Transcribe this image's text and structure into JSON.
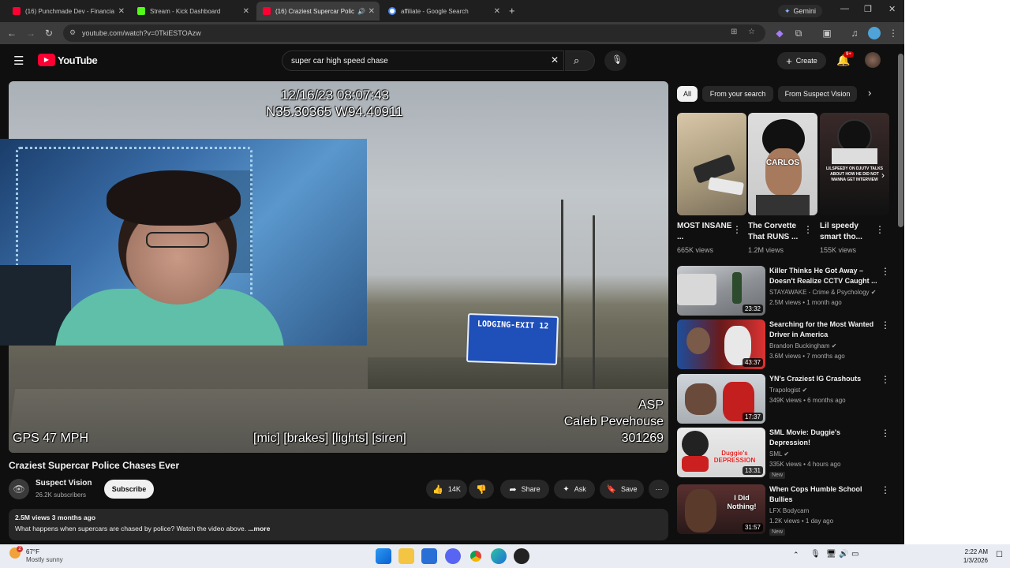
{
  "browser": {
    "tabs": [
      {
        "title": "(16) Punchmade Dev - Financia",
        "color": "#ff0033"
      },
      {
        "title": "Stream - Kick Dashboard",
        "color": "#53fc18"
      },
      {
        "title": "(16) Craziest Supercar Polic",
        "color": "#ff0033"
      },
      {
        "title": "affiliate - Google Search",
        "color": "#4285f4"
      }
    ],
    "gemini": "Gemini",
    "url": "youtube.com/watch?v=0TkiESTOAzw"
  },
  "youtube": {
    "logo": "YouTube",
    "search_query": "super car high speed chase",
    "create_label": "Create",
    "notifications": "9+"
  },
  "video": {
    "timestamp": "12/16/23 08:07:43",
    "coords": "N35.30365 W94.40911",
    "sign_text": "LODGING-EXIT 12",
    "gps": "GPS 47 MPH",
    "indicators": "[mic] [brakes] [lights] [siren]",
    "agency": "ASP",
    "officer": "Caleb Pevehouse",
    "unit": "301269",
    "title": "Craziest Supercar Police Chases Ever",
    "channel": "Suspect Vision",
    "subscribers": "26.2K subscribers",
    "subscribe_label": "Subscribe",
    "likes": "14K",
    "share_label": "Share",
    "ask_label": "Ask",
    "save_label": "Save",
    "views_age": "2.5M views  3 months ago",
    "description": "What happens when supercars are chased by police? Watch the video above.",
    "more": " ...more"
  },
  "chips": [
    "All",
    "From your search",
    "From Suspect Vision"
  ],
  "shorts": [
    {
      "title": "MOST INSANE ...",
      "views": "665K views",
      "overlay": ""
    },
    {
      "title": "The Corvette That RUNS ...",
      "views": "1.2M views",
      "overlay": "CARLOS"
    },
    {
      "title": "Lil speedy smart tho...",
      "views": "155K views",
      "overlay": "LILSPEEDY ON DJUTV TALKS ABOUT HOW HE DID NOT WANNA GET INTERVIEW"
    }
  ],
  "recommendations": [
    {
      "title": "Killer Thinks He Got Away – Doesn't Realize CCTV Caught ...",
      "channel": "STAYAWAKE - Crime & Psychology",
      "views": "2.5M views • 1 month ago",
      "duration": "23:32",
      "badge": ""
    },
    {
      "title": "Searching for the Most Wanted Driver in America",
      "channel": "Brandon Buckingham",
      "views": "3.6M views • 7 months ago",
      "duration": "43:37",
      "badge": ""
    },
    {
      "title": "YN's Craziest IG Crashouts",
      "channel": "Trapologist",
      "views": "349K views • 6 months ago",
      "duration": "17:37",
      "badge": ""
    },
    {
      "title": "SML Movie: Duggie's Depression!",
      "channel": "SML",
      "views": "335K views • 4 hours ago",
      "duration": "13:31",
      "badge": "New",
      "thumb_text": "Duggie's DEPRESSION"
    },
    {
      "title": "When Cops Humble School Bullies",
      "channel": "LFX Bodycam",
      "views": "1.2K views • 1 day ago",
      "duration": "31:57",
      "badge": "New",
      "thumb_text": "I Did Nothing!"
    }
  ],
  "taskbar": {
    "weather_temp": "67°F",
    "weather_desc": "Mostly sunny",
    "weather_badge": "2",
    "time": "2:22 AM",
    "date": "1/3/2026"
  }
}
